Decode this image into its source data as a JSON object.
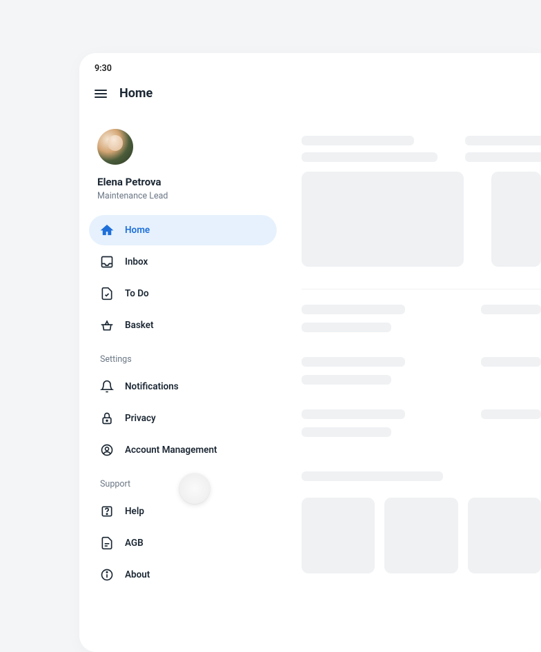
{
  "status": {
    "time": "9:30"
  },
  "header": {
    "title": "Home"
  },
  "profile": {
    "name": "Elena Petrova",
    "role": "Maintenance Lead"
  },
  "nav": {
    "main": [
      {
        "key": "home",
        "label": "Home",
        "active": true
      },
      {
        "key": "inbox",
        "label": "Inbox",
        "active": false
      },
      {
        "key": "todo",
        "label": "To Do",
        "active": false
      },
      {
        "key": "basket",
        "label": "Basket",
        "active": false
      }
    ],
    "sections": [
      {
        "title": "Settings",
        "items": [
          {
            "key": "notifications",
            "label": "Notifications"
          },
          {
            "key": "privacy",
            "label": "Privacy"
          },
          {
            "key": "account",
            "label": "Account Management"
          }
        ]
      },
      {
        "title": "Support",
        "items": [
          {
            "key": "help",
            "label": "Help"
          },
          {
            "key": "agb",
            "label": "AGB"
          },
          {
            "key": "about",
            "label": "About"
          }
        ]
      }
    ]
  }
}
